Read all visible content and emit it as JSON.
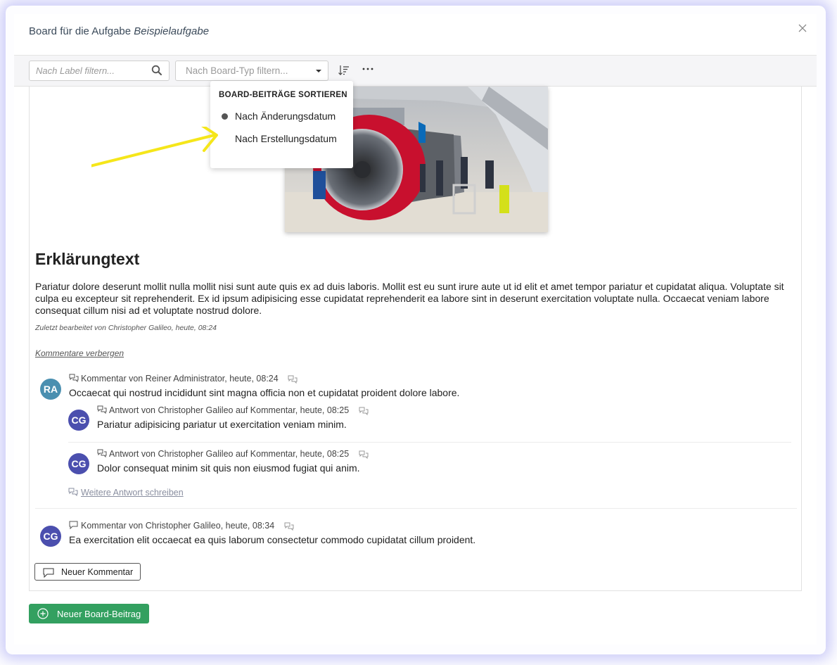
{
  "modal": {
    "title_prefix": "Board für die Aufgabe ",
    "title_task": "Beispielaufgabe"
  },
  "toolbar": {
    "label_filter_placeholder": "Nach Label filtern...",
    "type_filter_placeholder": "Nach Board-Typ filtern..."
  },
  "sort_menu": {
    "header": "BOARD-BEITRÄGE SORTIEREN",
    "items": [
      {
        "label": "Nach Änderungsdatum",
        "selected": true
      },
      {
        "label": "Nach Erstellungsdatum",
        "selected": false
      }
    ]
  },
  "post": {
    "title": "Erklärungtext",
    "body": "Pariatur dolore deserunt mollit nulla mollit nisi sunt aute quis ex ad duis laboris. Mollit est eu sunt irure aute ut id elit et amet tempor pariatur et cupidatat aliqua. Voluptate sit culpa eu excepteur sit reprehenderit. Ex id ipsum adipisicing esse cupidatat reprehenderit ea labore sint in deserunt exercitation voluptate nulla. Occaecat veniam labore consequat cillum nisi ad et voluptate nostrud dolore.",
    "edited": "Zuletzt bearbeitet von Christopher Galileo, heute, 08:24",
    "toggle_comments": "Kommentare verbergen"
  },
  "comments": [
    {
      "initials": "RA",
      "avatar_color": "#4a8fb0",
      "meta": "Kommentar von Reiner Administrator, heute, 08:24",
      "text": "Occaecat qui nostrud incididunt sint magna officia non et cupidatat proident dolore labore.",
      "replies": [
        {
          "initials": "CG",
          "avatar_color": "#4b4fae",
          "meta": "Antwort von Christopher Galileo auf Kommentar, heute, 08:25",
          "text": "Pariatur adipisicing pariatur ut exercitation veniam minim."
        },
        {
          "initials": "CG",
          "avatar_color": "#4b4fae",
          "meta": "Antwort von Christopher Galileo auf Kommentar, heute, 08:25",
          "text": "Dolor consequat minim sit quis non eiusmod fugiat qui anim."
        }
      ],
      "write_reply": "Weitere Antwort schreiben"
    },
    {
      "initials": "CG",
      "avatar_color": "#4b4fae",
      "meta": "Kommentar von Christopher Galileo, heute, 08:34",
      "text": "Ea exercitation elit occaecat ea quis laborum consectetur commodo cupidatat cillum proident."
    }
  ],
  "buttons": {
    "new_comment": "Neuer Kommentar",
    "new_post": "Neuer Board-Beitrag"
  },
  "colors": {
    "primary_green": "#33a060",
    "annotation_arrow": "#f5e61a"
  }
}
